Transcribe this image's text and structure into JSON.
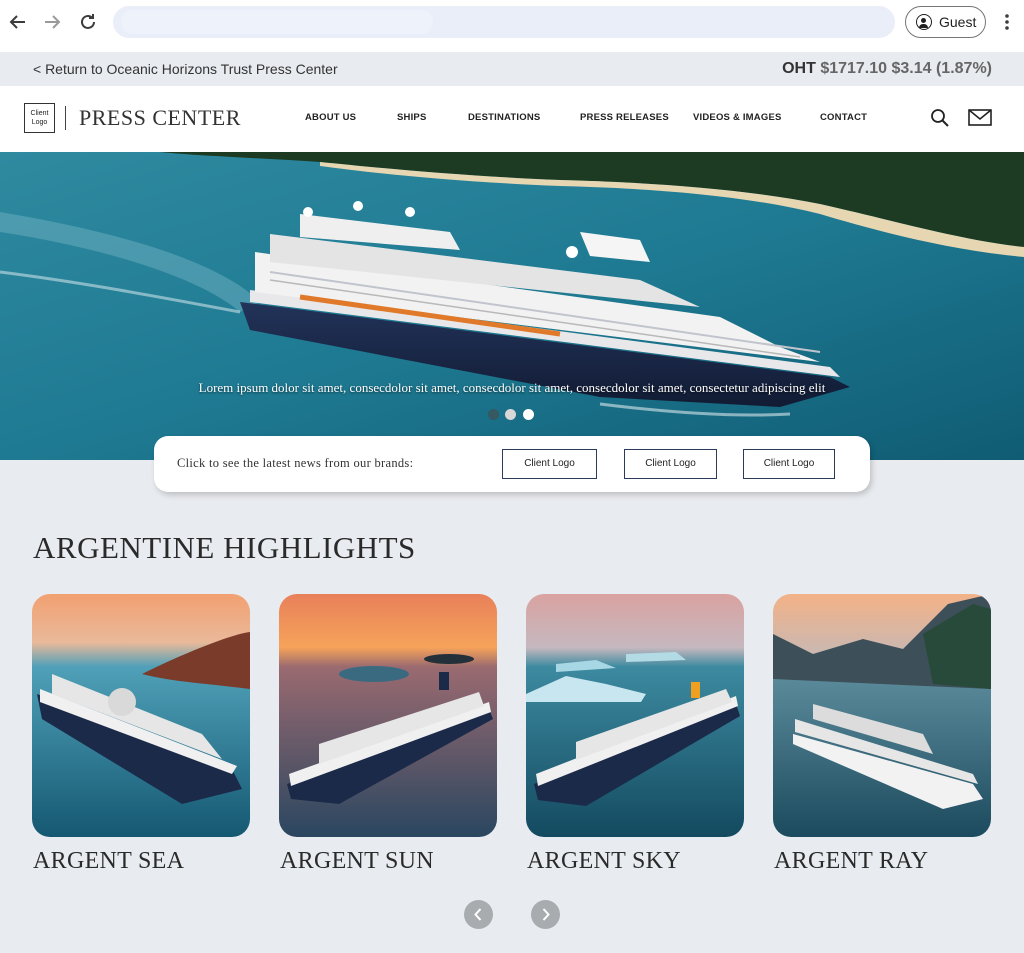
{
  "browser": {
    "back_icon": "arrow-left-icon",
    "forward_icon": "arrow-right-icon",
    "reload_icon": "reload-icon",
    "profile_label": "Guest",
    "menu_icon": "kebab-icon"
  },
  "topbar": {
    "return_link": "< Return to Oceanic Horizons Trust Press Center",
    "stock_symbol": "OHT",
    "stock_quote": "$1717.10 $3.14 (1.87%)"
  },
  "header": {
    "logo_text": "Client Logo",
    "title": "PRESS CENTER",
    "nav": [
      "ABOUT US",
      "SHIPS",
      "DESTINATIONS",
      "PRESS RELEASES",
      "VIDEOS & IMAGES",
      "CONTACT"
    ],
    "search_icon": "search-icon",
    "mail_icon": "mail-icon"
  },
  "hero": {
    "caption": "Lorem ipsum dolor sit amet, consecdolor sit amet, consecdolor sit amet, consecdolor sit amet, consectetur adipiscing elit",
    "slides": 3,
    "active_slide": 1
  },
  "brands": {
    "prompt": "Click to see the latest news from our brands:",
    "logos": [
      "Client Logo",
      "Client Logo",
      "Client Logo"
    ]
  },
  "highlights": {
    "title": "ARGENTINE HIGHLIGHTS",
    "ships": [
      {
        "name": "ARGENT SEA"
      },
      {
        "name": "ARGENT SUN"
      },
      {
        "name": "ARGENT SKY"
      },
      {
        "name": "ARGENT RAY"
      }
    ],
    "prev_icon": "chevron-left-icon",
    "next_icon": "chevron-right-icon"
  },
  "colors": {
    "page_bg": "#e8ebef",
    "header_bg": "#ffffff",
    "text_dark": "#2a2a2a",
    "sea": "#1f7f94",
    "hull": "#1c2a4a"
  }
}
